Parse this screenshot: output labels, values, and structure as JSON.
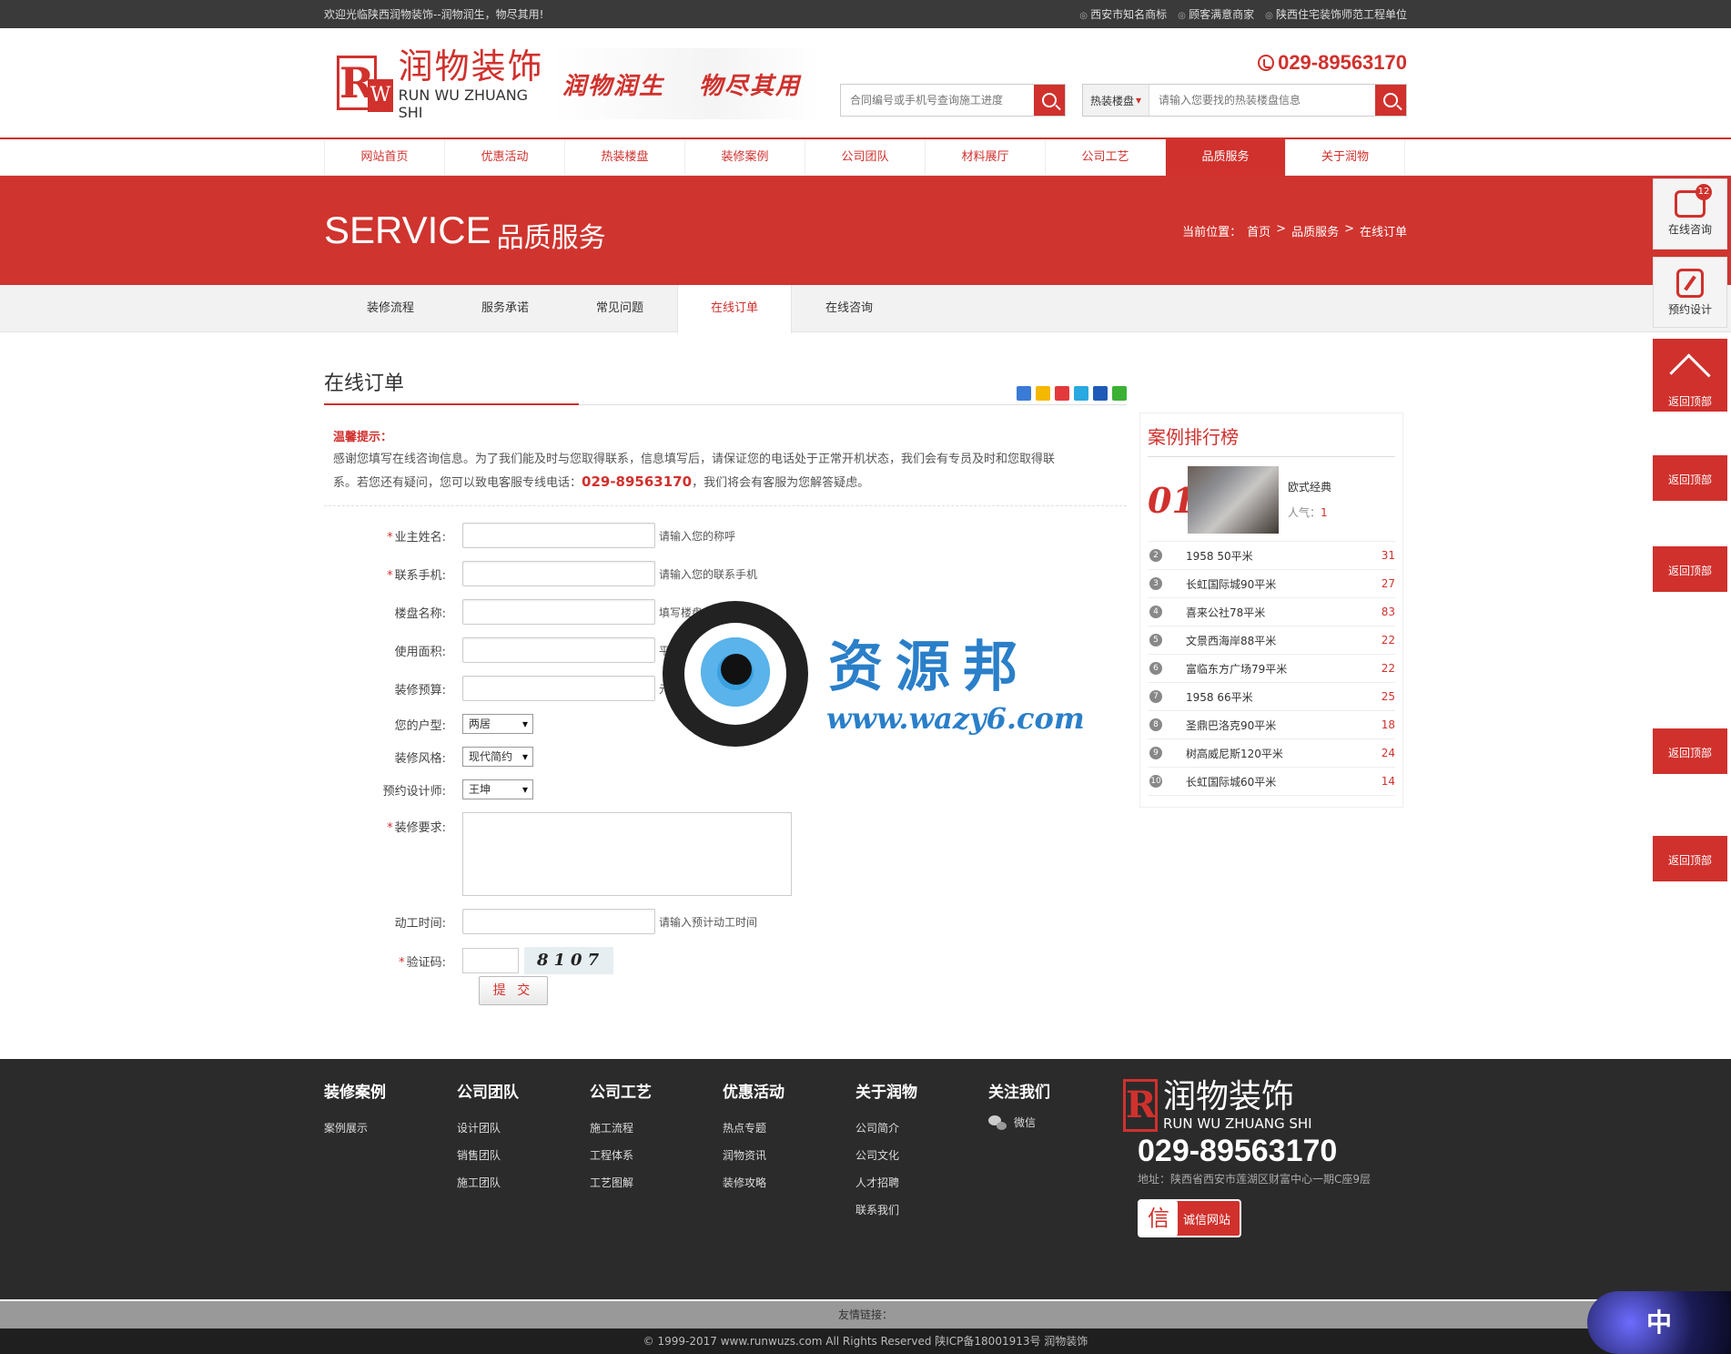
{
  "topbar": {
    "welcome": "欢迎光临陕西润物装饰--润物润生，物尽其用!",
    "badges": [
      "西安市知名商标",
      "顾客满意商家",
      "陕西住宅装饰师范工程单位"
    ]
  },
  "header": {
    "logo_cn": "润物装饰",
    "logo_en": "RUN WU ZHUANG SHI",
    "logo_r": "R",
    "logo_w": "W",
    "slogan_1": "润物润生",
    "slogan_2": "物尽其用",
    "phone": "029-89563170",
    "search1_placeholder": "合同编号或手机号查询施工进度",
    "search2_select": "热装楼盘",
    "search2_placeholder": "请输入您要找的热装楼盘信息"
  },
  "nav": {
    "items": [
      "网站首页",
      "优惠活动",
      "热装楼盘",
      "装修案例",
      "公司团队",
      "材料展厅",
      "公司工艺",
      "品质服务",
      "关于润物"
    ],
    "active_index": 7
  },
  "banner": {
    "title_en": "SERVICE",
    "title_cn": "品质服务",
    "crumb_label": "当前位置：",
    "crumb_1": "首页",
    "crumb_2": "品质服务",
    "crumb_3": "在线订单",
    "sep": ">"
  },
  "subnav": {
    "items": [
      "装修流程",
      "服务承诺",
      "常见问题",
      "在线订单",
      "在线咨询"
    ],
    "active_index": 3
  },
  "page": {
    "title": "在线订单",
    "tips_title": "温馨提示：",
    "tips_text_1": "感谢您填写在线咨询信息。为了我们能及时与您取得联系，信息填写后，请保证您的电话处于正常开机状态，我们会有专员及时和您取得联",
    "tips_text_2": "系。若您还有疑问，您可以致电客服专线电话：",
    "tips_tel": "029-89563170",
    "tips_text_3": "，我们将会有客服为您解答疑虑。"
  },
  "form": {
    "owner_label": "业主姓名:",
    "owner_hint": "请输入您的称呼",
    "mobile_label": "联系手机:",
    "mobile_hint": "请输入您的联系手机",
    "estate_label": "楼盘名称:",
    "estate_hint": "填写楼盘名称",
    "area_label": "使用面积:",
    "area_hint": "平米",
    "budget_label": "装修预算:",
    "budget_hint": "元",
    "house_label": "您的户型:",
    "house_value": "两居",
    "style_label": "装修风格:",
    "style_value": "现代简约",
    "designer_label": "预约设计师:",
    "designer_value": "王坤",
    "req_label": "装修要求:",
    "start_label": "动工时间:",
    "start_hint": "请输入预计动工时间",
    "captcha_label": "验证码:",
    "captcha_text": "8107",
    "required_mark": "*",
    "submit": "提 交"
  },
  "ranking": {
    "title": "案例排行榜",
    "top": {
      "num": "01",
      "name": "欧式经典",
      "hot_label": "人气：",
      "hot": "1"
    },
    "items": [
      {
        "n": "2",
        "name": "1958 50平米",
        "v": "31"
      },
      {
        "n": "3",
        "name": "长虹国际城90平米",
        "v": "27"
      },
      {
        "n": "4",
        "name": "喜来公社78平米",
        "v": "83"
      },
      {
        "n": "5",
        "name": "文景西海岸88平米",
        "v": "22"
      },
      {
        "n": "6",
        "name": "富临东方广场79平米",
        "v": "22"
      },
      {
        "n": "7",
        "name": "1958 66平米",
        "v": "25"
      },
      {
        "n": "8",
        "name": "圣鼎巴洛克90平米",
        "v": "18"
      },
      {
        "n": "9",
        "name": "树高威尼斯120平米",
        "v": "24"
      },
      {
        "n": "10",
        "name": "长虹国际城60平米",
        "v": "14"
      }
    ]
  },
  "sidebar": {
    "chat_label": "在线咨询",
    "chat_badge": "12",
    "design_label": "预约设计",
    "top_label": "返回顶部"
  },
  "footer": {
    "cols": [
      {
        "title": "装修案例",
        "links": [
          "案例展示"
        ]
      },
      {
        "title": "公司团队",
        "links": [
          "设计团队",
          "销售团队",
          "施工团队"
        ]
      },
      {
        "title": "公司工艺",
        "links": [
          "施工流程",
          "工程体系",
          "工艺图解"
        ]
      },
      {
        "title": "优惠活动",
        "links": [
          "热点专题",
          "润物资讯",
          "装修攻略"
        ]
      },
      {
        "title": "关于润物",
        "links": [
          "公司简介",
          "公司文化",
          "人才招聘",
          "联系我们"
        ]
      }
    ],
    "follow_title": "关注我们",
    "wechat": "微信",
    "logo_cn": "润物装饰",
    "logo_en": "RUN WU ZHUANG SHI",
    "phone": "029-89563170",
    "address": "地址：陕西省西安市莲湖区财富中心一期C座9层",
    "credit_char": "信",
    "credit_text": "诚信网站",
    "links_label": "友情链接：",
    "copyright": "© 1999-2017 www.runwuzs.com All Rights Reserved 陕ICP备18001913号 润物装饰"
  },
  "watermark": {
    "cn": "资源邦",
    "en": "www.wazy6.com"
  },
  "ime": {
    "label": "中"
  },
  "colors": {
    "brand": "#d0312d",
    "dark": "#2b2b2b"
  }
}
